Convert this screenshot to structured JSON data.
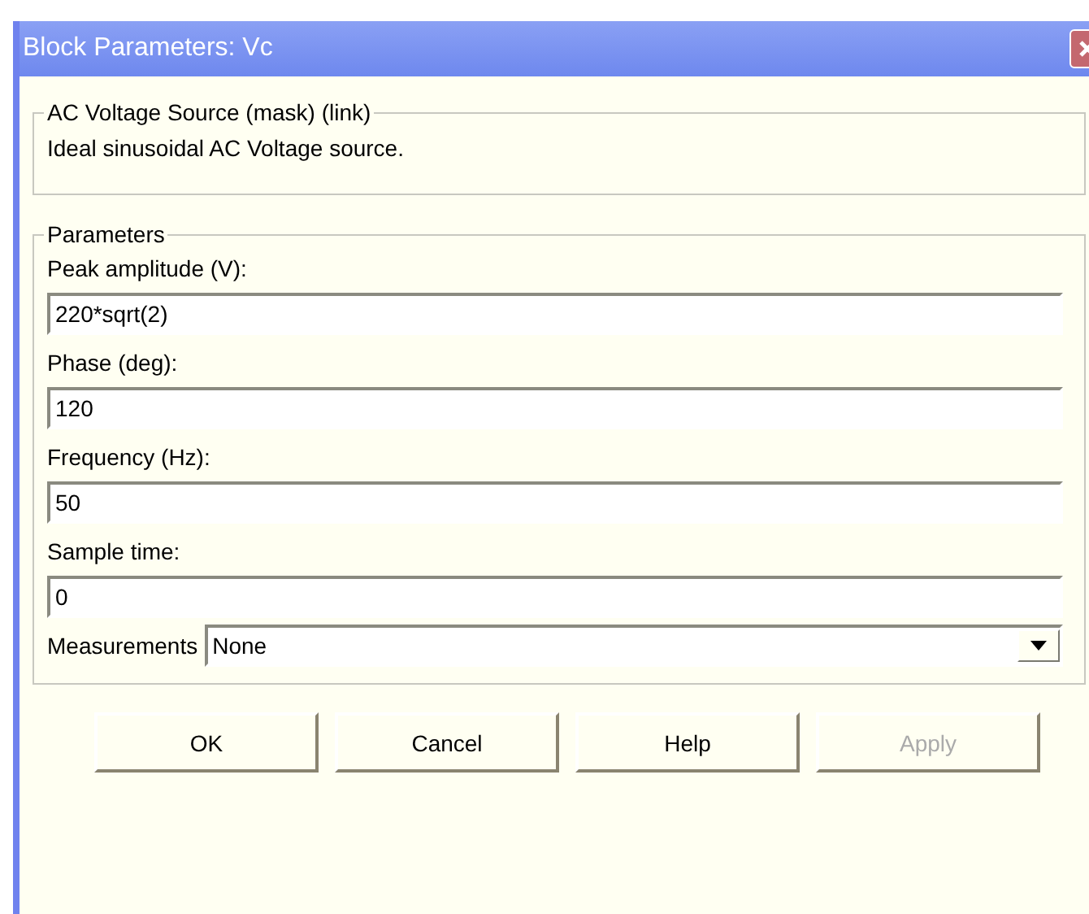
{
  "window": {
    "title": "Block Parameters: Vc"
  },
  "description_group": {
    "title": "AC Voltage Source (mask) (link)",
    "text": "Ideal sinusoidal AC Voltage source."
  },
  "parameters_group": {
    "title": "Parameters",
    "fields": [
      {
        "label": "Peak amplitude (V):",
        "value": "220*sqrt(2)"
      },
      {
        "label": "Phase (deg):",
        "value": "120"
      },
      {
        "label": "Frequency (Hz):",
        "value": "50"
      },
      {
        "label": "Sample time:",
        "value": "0"
      }
    ],
    "measurements": {
      "label": "Measurements",
      "value": "None"
    }
  },
  "buttons": [
    {
      "label": "OK",
      "disabled": false
    },
    {
      "label": "Cancel",
      "disabled": false
    },
    {
      "label": "Help",
      "disabled": false
    },
    {
      "label": "Apply",
      "disabled": true
    }
  ]
}
